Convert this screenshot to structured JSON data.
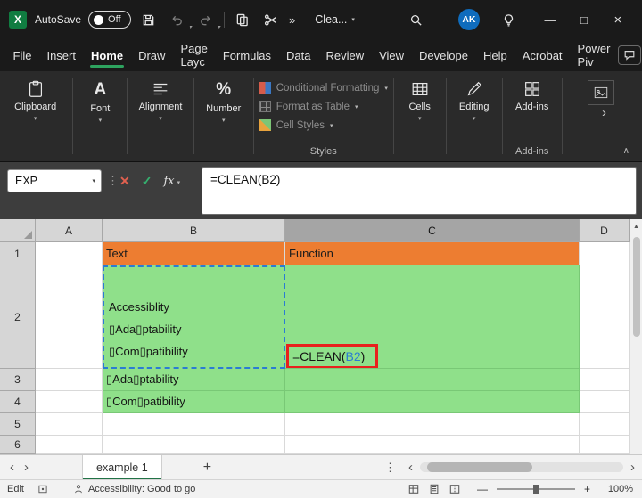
{
  "titlebar": {
    "autosave_label": "AutoSave",
    "autosave_state": "Off",
    "overflow_glyph": "»",
    "doc_name": "Clea...",
    "avatar_initials": "AK"
  },
  "ribbon_tabs": {
    "items": [
      "File",
      "Insert",
      "Home",
      "Draw",
      "Page Layc",
      "Formulas",
      "Data",
      "Review",
      "View",
      "Develope",
      "Help",
      "Acrobat",
      "Power Piv"
    ]
  },
  "ribbon": {
    "clipboard_label": "Clipboard",
    "font_label": "Font",
    "alignment_label": "Alignment",
    "number_label": "Number",
    "conditional_formatting_label": "Conditional Formatting",
    "format_as_table_label": "Format as Table",
    "cell_styles_label": "Cell Styles",
    "styles_group_label": "Styles",
    "cells_label": "Cells",
    "editing_label": "Editing",
    "addins_label": "Add-ins",
    "addins_group_label": "Add-ins"
  },
  "formula_bar": {
    "name_box_value": "EXP",
    "fx_label": "fx",
    "formula": "=CLEAN(B2)"
  },
  "grid": {
    "col_headers": [
      "A",
      "B",
      "C",
      "D"
    ],
    "row_headers": [
      "1",
      "2",
      "3",
      "4",
      "5",
      "6"
    ],
    "cells": {
      "b1": "Text",
      "c1": "Function",
      "b2_line1": "Accessiblity",
      "b2_line2": "▯Ada▯ptability",
      "b2_line3": "▯Com▯patibility",
      "c2_formula_prefix": "=CLEAN(",
      "c2_formula_ref": "B2",
      "c2_formula_suffix": ")",
      "b3": "▯Ada▯ptability",
      "b4": "▯Com▯patibility"
    }
  },
  "sheet_bar": {
    "active_tab": "example 1"
  },
  "status_bar": {
    "mode": "Edit",
    "accessibility_text": "Accessibility: Good to go",
    "zoom_level": "100%"
  },
  "colors": {
    "excel_green": "#107C41",
    "header_orange": "#ED7D31",
    "fill_green": "#8FE08A",
    "reference_blue": "#2B7CD3",
    "annotation_red": "#E8211D"
  }
}
